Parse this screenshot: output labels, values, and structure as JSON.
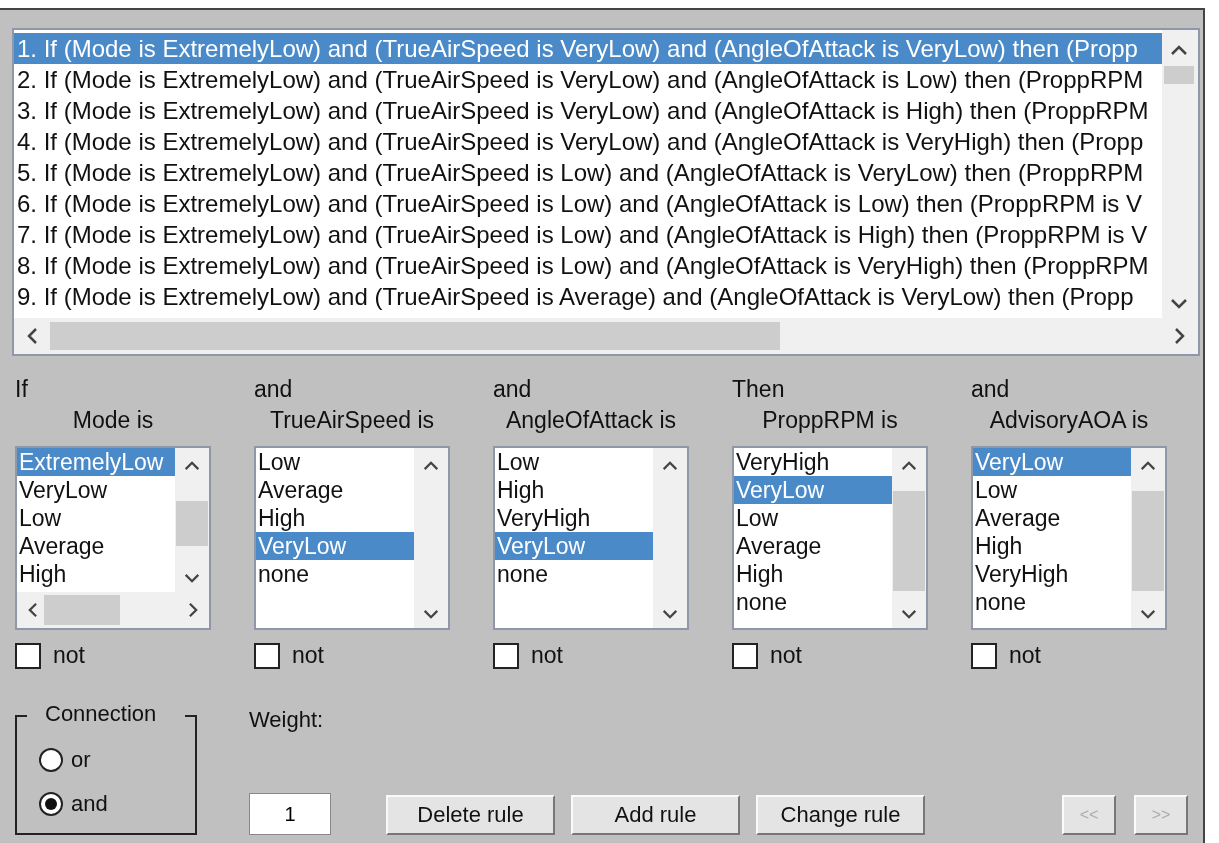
{
  "rules": [
    {
      "text": "1. If (Mode is ExtremelyLow) and (TrueAirSpeed is VeryLow) and (AngleOfAttack is VeryLow) then (Propp",
      "selected": true
    },
    {
      "text": "2. If (Mode is ExtremelyLow) and (TrueAirSpeed is VeryLow) and (AngleOfAttack is Low) then (ProppRPM",
      "selected": false
    },
    {
      "text": "3. If (Mode is ExtremelyLow) and (TrueAirSpeed is VeryLow) and (AngleOfAttack is High) then (ProppRPM",
      "selected": false
    },
    {
      "text": "4. If (Mode is ExtremelyLow) and (TrueAirSpeed is VeryLow) and (AngleOfAttack is VeryHigh) then (Propp",
      "selected": false
    },
    {
      "text": "5. If (Mode is ExtremelyLow) and (TrueAirSpeed is Low) and (AngleOfAttack is VeryLow) then (ProppRPM",
      "selected": false
    },
    {
      "text": "6. If (Mode is ExtremelyLow) and (TrueAirSpeed is Low) and (AngleOfAttack is Low) then (ProppRPM is V",
      "selected": false
    },
    {
      "text": "7. If (Mode is ExtremelyLow) and (TrueAirSpeed is Low) and (AngleOfAttack is High) then (ProppRPM is V",
      "selected": false
    },
    {
      "text": "8. If (Mode is ExtremelyLow) and (TrueAirSpeed is Low) and (AngleOfAttack is VeryHigh) then (ProppRPM",
      "selected": false
    },
    {
      "text": "9. If (Mode is ExtremelyLow) and (TrueAirSpeed is Average) and (AngleOfAttack is VeryLow) then (Propp",
      "selected": false
    }
  ],
  "variables": [
    {
      "connector": "If",
      "label": "Mode is",
      "horizontal_scrollbar": true,
      "not_checked": false,
      "not_label": "not",
      "options": [
        {
          "text": "ExtremelyLow",
          "selected": true
        },
        {
          "text": "VeryLow",
          "selected": false
        },
        {
          "text": "Low",
          "selected": false
        },
        {
          "text": "Average",
          "selected": false
        },
        {
          "text": "High",
          "selected": false
        }
      ]
    },
    {
      "connector": "and",
      "label": "TrueAirSpeed is",
      "horizontal_scrollbar": false,
      "not_checked": false,
      "not_label": "not",
      "options": [
        {
          "text": "Low",
          "selected": false
        },
        {
          "text": "Average",
          "selected": false
        },
        {
          "text": "High",
          "selected": false
        },
        {
          "text": "VeryLow",
          "selected": true
        },
        {
          "text": "none",
          "selected": false
        }
      ]
    },
    {
      "connector": "and",
      "label": "AngleOfAttack is",
      "horizontal_scrollbar": false,
      "not_checked": false,
      "not_label": "not",
      "options": [
        {
          "text": "Low",
          "selected": false
        },
        {
          "text": "High",
          "selected": false
        },
        {
          "text": "VeryHigh",
          "selected": false
        },
        {
          "text": "VeryLow",
          "selected": true
        },
        {
          "text": "none",
          "selected": false
        }
      ]
    },
    {
      "connector": "Then",
      "label": "ProppRPM is",
      "horizontal_scrollbar": false,
      "not_checked": false,
      "not_label": "not",
      "options": [
        {
          "text": "VeryHigh",
          "selected": false
        },
        {
          "text": "VeryLow",
          "selected": true
        },
        {
          "text": "Low",
          "selected": false
        },
        {
          "text": "Average",
          "selected": false
        },
        {
          "text": "High",
          "selected": false
        },
        {
          "text": "none",
          "selected": false
        }
      ]
    },
    {
      "connector": "and",
      "label": "AdvisoryAOA is",
      "horizontal_scrollbar": false,
      "not_checked": false,
      "not_label": "not",
      "options": [
        {
          "text": "VeryLow",
          "selected": true
        },
        {
          "text": "Low",
          "selected": false
        },
        {
          "text": "Average",
          "selected": false
        },
        {
          "text": "High",
          "selected": false
        },
        {
          "text": "VeryHigh",
          "selected": false
        },
        {
          "text": "none",
          "selected": false
        }
      ]
    }
  ],
  "connection": {
    "title": "Connection",
    "options": [
      {
        "label": "or",
        "selected": false
      },
      {
        "label": "and",
        "selected": true
      }
    ]
  },
  "weight": {
    "label": "Weight:",
    "value": "1"
  },
  "buttons": [
    {
      "label": "Delete rule",
      "disabled": false
    },
    {
      "label": "Add rule",
      "disabled": false
    },
    {
      "label": "Change rule",
      "disabled": false
    }
  ],
  "nav_buttons": [
    {
      "label": "<<",
      "disabled": true
    },
    {
      "label": ">>",
      "disabled": true
    }
  ]
}
